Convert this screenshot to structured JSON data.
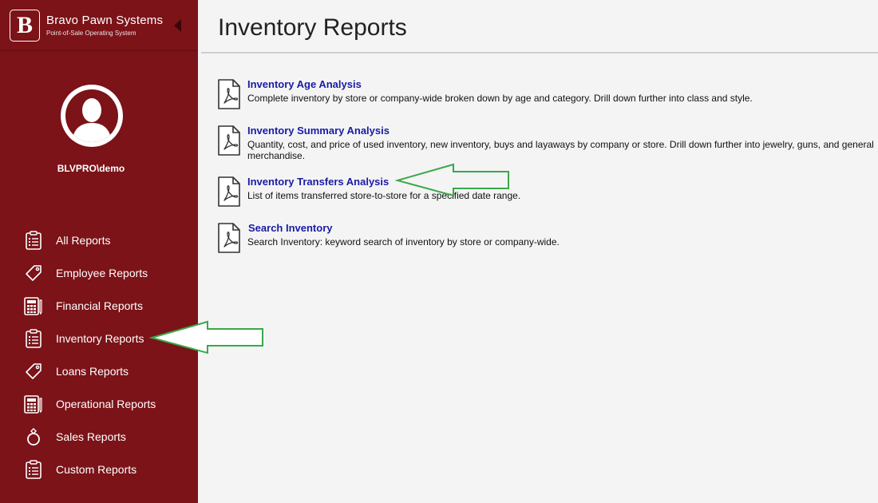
{
  "brand": {
    "logo_letter": "B",
    "name": "Bravo Pawn Systems",
    "tagline": "Point-of-Sale Operating System"
  },
  "user": {
    "name": "BLVPRO\\demo"
  },
  "nav": [
    {
      "label": "All Reports",
      "icon": "clipboard-icon"
    },
    {
      "label": "Employee Reports",
      "icon": "tag-icon"
    },
    {
      "label": "Financial Reports",
      "icon": "calculator-icon"
    },
    {
      "label": "Inventory Reports",
      "icon": "clipboard-icon"
    },
    {
      "label": "Loans Reports",
      "icon": "tag-icon"
    },
    {
      "label": "Operational Reports",
      "icon": "calculator-icon"
    },
    {
      "label": "Sales Reports",
      "icon": "ring-icon"
    },
    {
      "label": "Custom Reports",
      "icon": "clipboard-icon"
    }
  ],
  "page": {
    "title": "Inventory Reports"
  },
  "reports": [
    {
      "title": "Inventory Age Analysis",
      "description": "Complete inventory by store or company-wide broken down by age and category. Drill down further into class and style."
    },
    {
      "title": "Inventory Summary Analysis",
      "description": "Quantity, cost, and price of used inventory, new inventory, buys and layaways by company or store. Drill down further into jewelry, guns, and general merchandise."
    },
    {
      "title": "Inventory Transfers Analysis",
      "description": "List of items transferred store-to-store for a specified date range."
    },
    {
      "title": "Search Inventory",
      "description": "Search Inventory: keyword search of inventory by store or company-wide."
    }
  ],
  "colors": {
    "sidebar": "#7b1318",
    "link": "#1a1aa6",
    "annotation_arrow": "#3aa84a"
  }
}
